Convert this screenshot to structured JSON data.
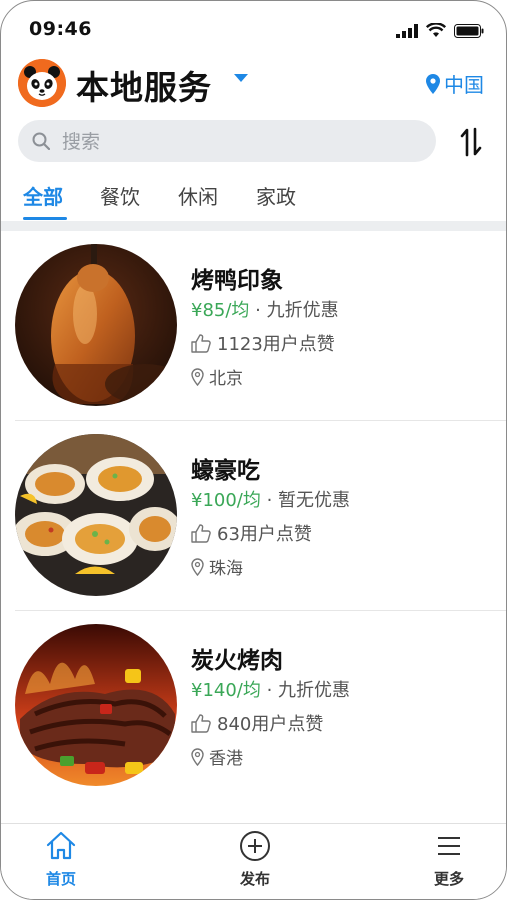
{
  "status": {
    "time": "09:46"
  },
  "header": {
    "title": "本地服务",
    "location": "中国"
  },
  "search": {
    "placeholder": "搜索"
  },
  "tabs": [
    {
      "label": "全部",
      "active": true
    },
    {
      "label": "餐饮",
      "active": false
    },
    {
      "label": "休闲",
      "active": false
    },
    {
      "label": "家政",
      "active": false
    }
  ],
  "items": [
    {
      "name": "烤鸭印象",
      "price": "¥85/均",
      "discount": "九折优惠",
      "likes": "1123用户点赞",
      "city": "北京",
      "image": "roast-duck"
    },
    {
      "name": "蠔豪吃",
      "price": "¥100/均",
      "discount": "暂无优惠",
      "likes": "63用户点赞",
      "city": "珠海",
      "image": "oysters"
    },
    {
      "name": "炭火烤肉",
      "price": "¥140/均",
      "discount": "九折优惠",
      "likes": "840用户点赞",
      "city": "香港",
      "image": "grilled-meat"
    }
  ],
  "price_separator": " · ",
  "bottom_nav": [
    {
      "label": "首页",
      "icon": "home-icon",
      "active": true
    },
    {
      "label": "发布",
      "icon": "plus-circle-icon",
      "active": false
    },
    {
      "label": "更多",
      "icon": "menu-icon",
      "active": false
    }
  ],
  "colors": {
    "accent": "#1e88e5",
    "price": "#3aa757",
    "brand": "#f06a1e"
  }
}
